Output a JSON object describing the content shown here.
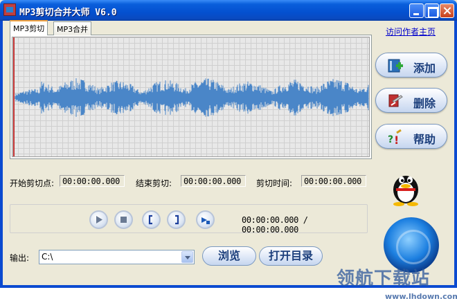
{
  "window": {
    "title": "MP3剪切合并大师 V6.0"
  },
  "tabs": [
    {
      "label": "MP3剪切"
    },
    {
      "label": "MP3合并"
    }
  ],
  "author_link": "访问作者主页",
  "buttons": {
    "add": "添加",
    "delete": "删除",
    "help": "帮助",
    "browse": "浏览",
    "open_dir": "打开目录"
  },
  "fields": {
    "start": {
      "label": "开始剪切点:",
      "value": "00:00:00.000"
    },
    "end": {
      "label": "结束剪切:",
      "value": "00:00:00.000"
    },
    "duration": {
      "label": "剪切时间:",
      "value": "00:00:00.000"
    }
  },
  "player": {
    "time_display": "00:00:00.000 / 00:00:00.000"
  },
  "output": {
    "label": "输出:",
    "value": "C:\\"
  },
  "watermark": {
    "text": "领航下载站",
    "url": "www.lhdown.com"
  },
  "colors": {
    "title_bar": "#0450d0",
    "wave": "#4a86c8",
    "grid": "#cfcfcf",
    "cursor": "#c03030"
  },
  "icons": [
    "app-icon",
    "add-file-icon",
    "delete-icon",
    "help-icon",
    "play-icon",
    "stop-icon",
    "mark-start-icon",
    "mark-end-icon",
    "play-selection-icon",
    "qq-penguin-icon",
    "music-disc-icon"
  ]
}
